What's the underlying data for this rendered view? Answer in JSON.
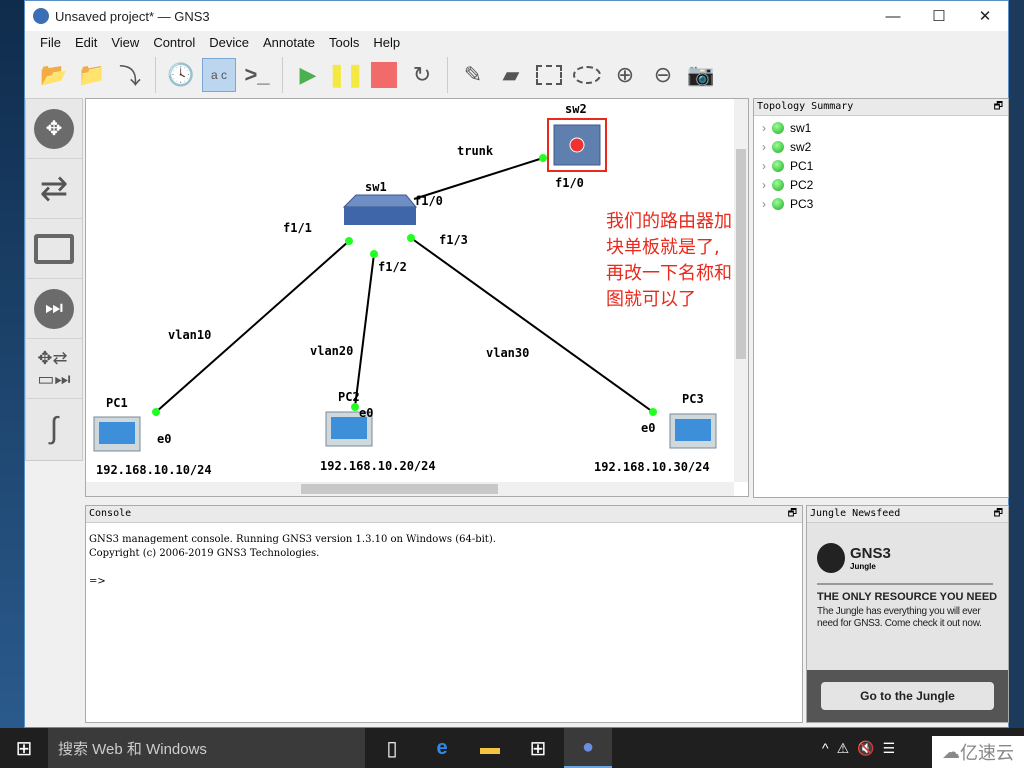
{
  "window": {
    "title": "Unsaved project* — GNS3",
    "minimize": "—",
    "maximize": "☐",
    "close": "✕"
  },
  "menu": [
    "File",
    "Edit",
    "View",
    "Control",
    "Device",
    "Annotate",
    "Tools",
    "Help"
  ],
  "toolbar": [
    "new-project",
    "open-project",
    "save-project",
    "snapshot",
    "show-interface-labels",
    "console-all",
    "start-all",
    "suspend-all",
    "stop-all",
    "reload-all",
    "add-note",
    "insert-picture",
    "draw-rectangle",
    "draw-ellipse",
    "zoom-in",
    "zoom-out",
    "screenshot"
  ],
  "devices": [
    "routers",
    "switches",
    "end-devices",
    "security-devices",
    "all-devices",
    "add-link"
  ],
  "topology": {
    "nodes": [
      {
        "name": "sw1"
      },
      {
        "name": "sw2"
      },
      {
        "name": "PC1",
        "ip": "192.168.10.10/24"
      },
      {
        "name": "PC2",
        "ip": "192.168.10.20/24"
      },
      {
        "name": "PC3",
        "ip": "192.168.10.30/24"
      }
    ],
    "links": [
      {
        "label": "trunk",
        "a": "f1/0",
        "b": "f1/0"
      },
      {
        "label": "vlan10",
        "a": "f1/1",
        "b": "e0"
      },
      {
        "label": "vlan20",
        "a": "f1/2",
        "b": "e0"
      },
      {
        "label": "vlan30",
        "a": "f1/3",
        "b": "e0"
      }
    ],
    "annotation_line1": "我们的路由器加块单板就是了,",
    "annotation_line2": "再改一下名称和图就可以了",
    "annotation_color": "#e8291c",
    "selection_color": "#e8291c"
  },
  "summary": {
    "title": "Topology Summary",
    "items": [
      "sw1",
      "sw2",
      "PC1",
      "PC2",
      "PC3"
    ]
  },
  "console": {
    "title": "Console",
    "lines": [
      "GNS3 management console. Running GNS3 version 1.3.10 on Windows (64-bit).",
      "Copyright (c) 2006-2019 GNS3 Technologies.",
      "",
      "=>"
    ]
  },
  "jungle": {
    "title": "Jungle Newsfeed",
    "logo": "GNS3",
    "logo_sub": "Jungle",
    "headline": "THE ONLY RESOURCE YOU NEED",
    "body": "The Jungle has everything you will ever need for GNS3. Come check it out now.",
    "button": "Go to the Jungle"
  },
  "taskbar": {
    "search_placeholder": "搜索 Web 和 Windows",
    "watermark": "亿速云"
  }
}
